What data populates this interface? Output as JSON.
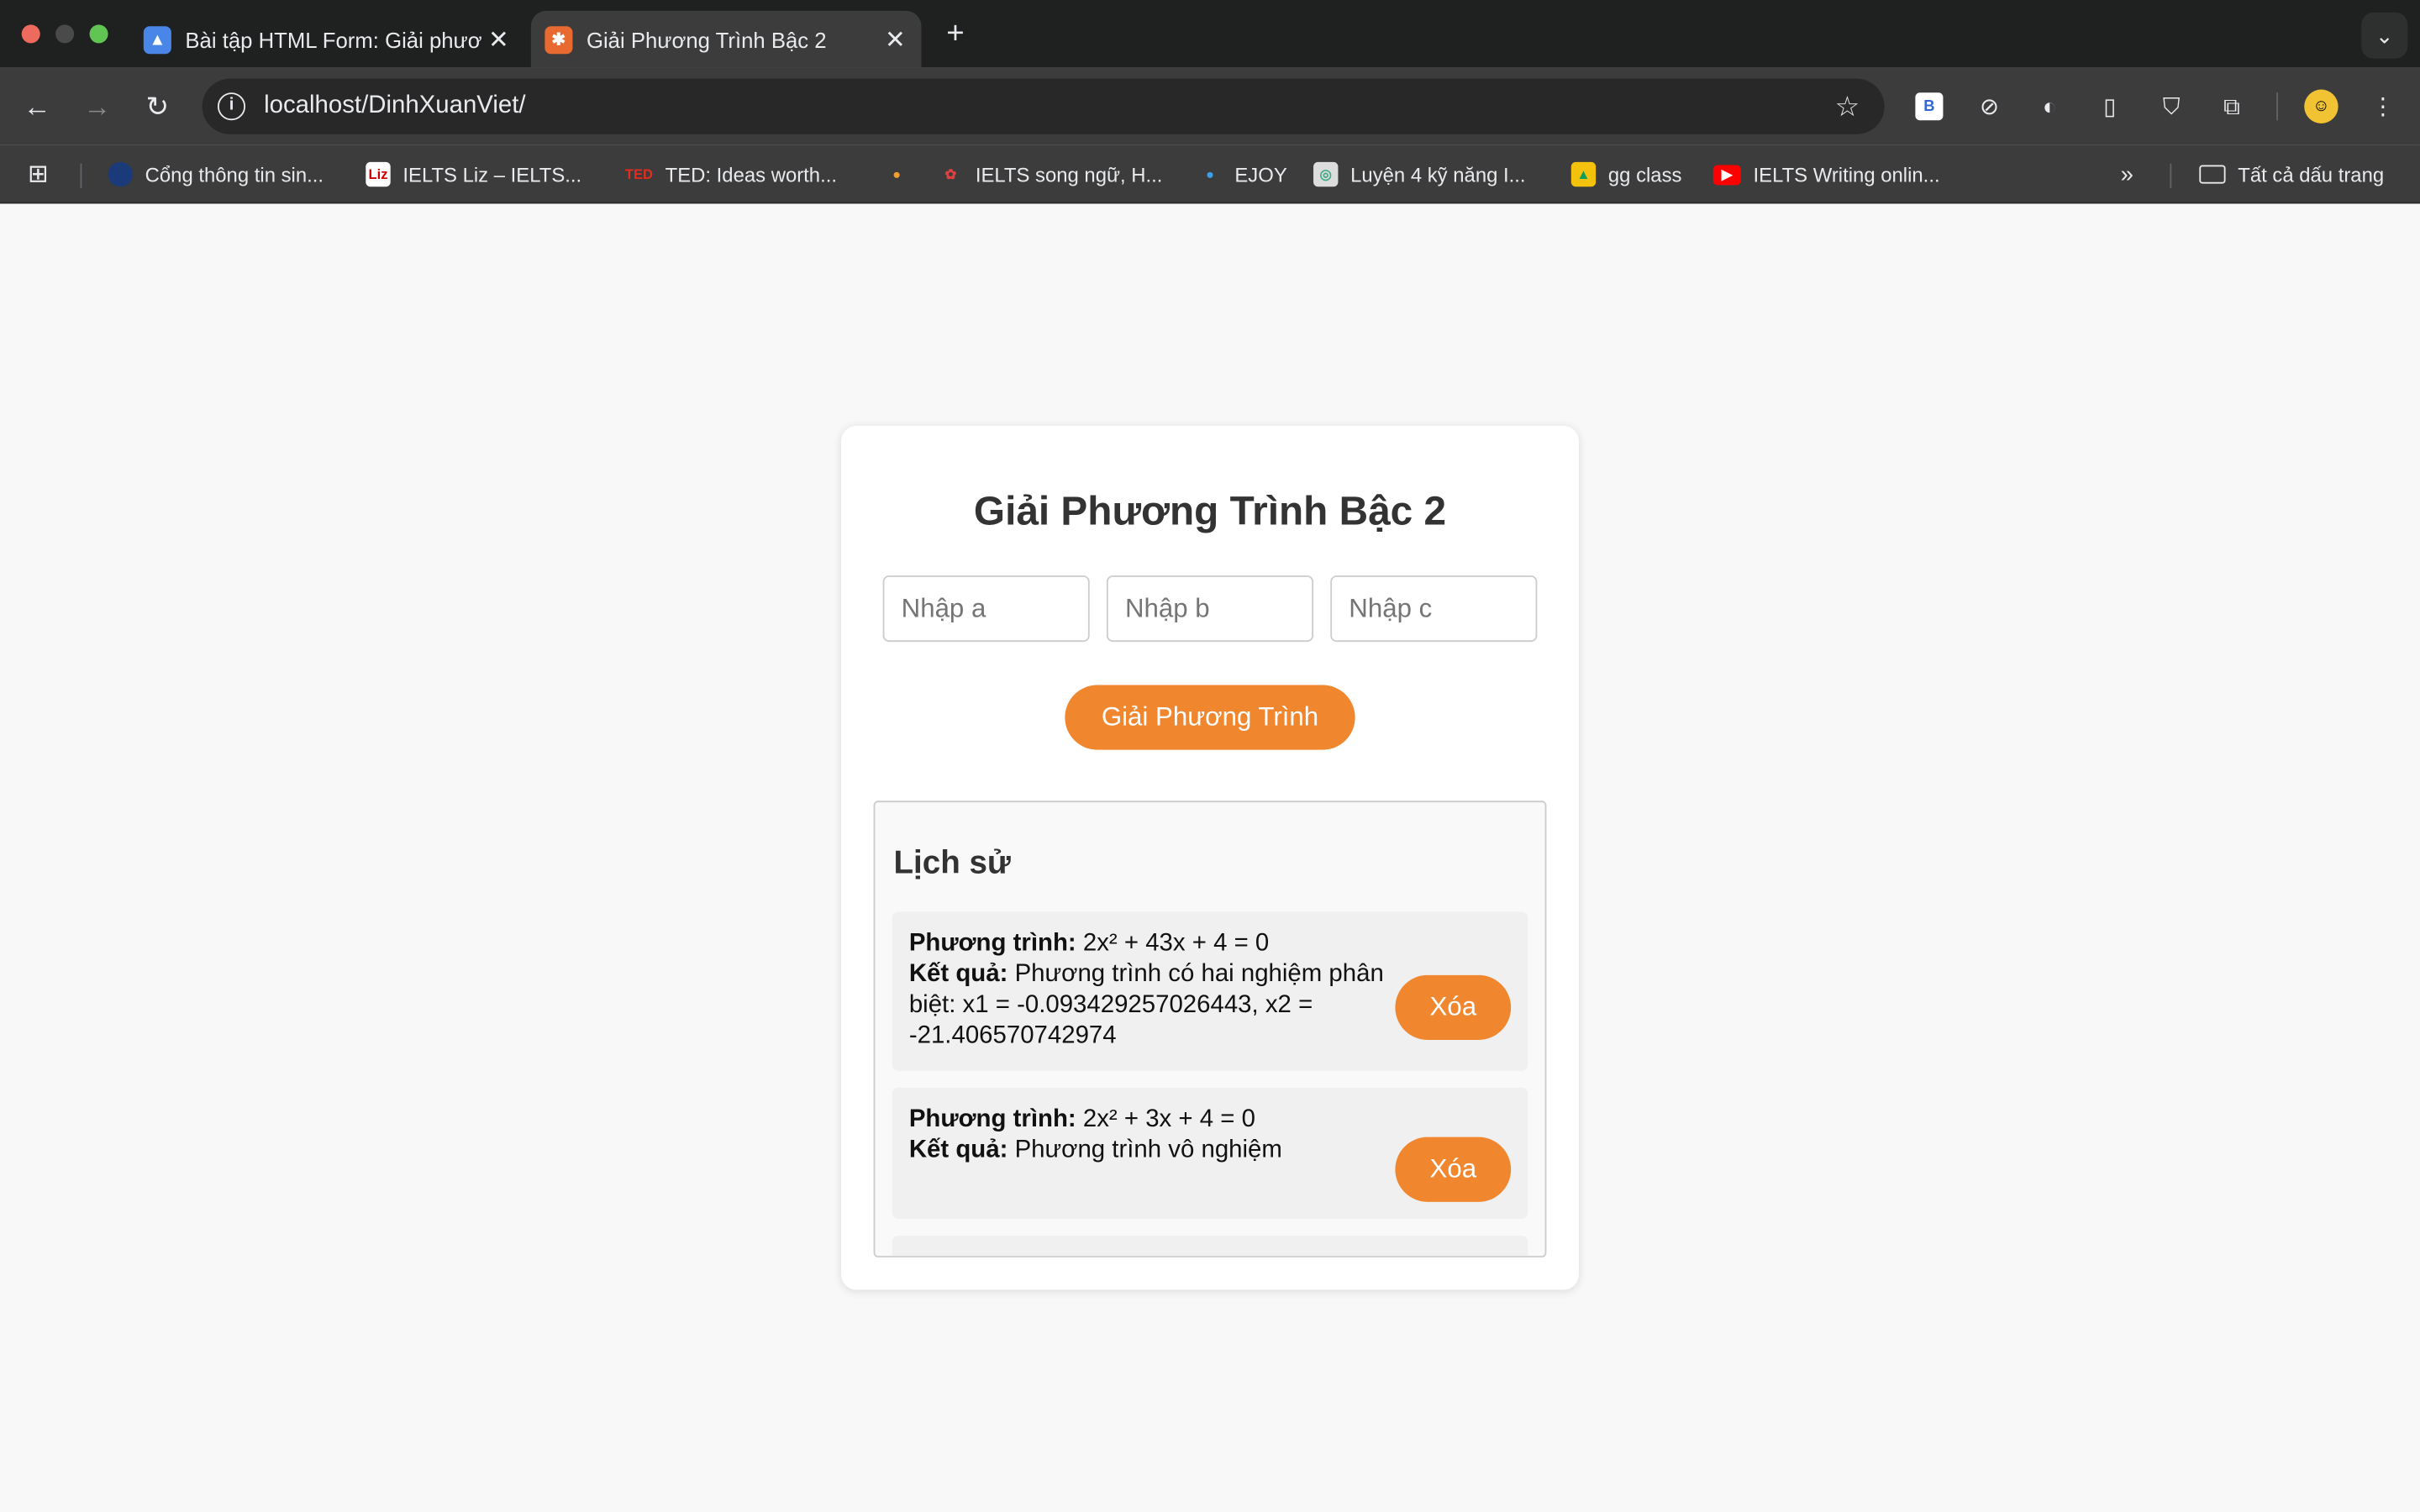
{
  "browser": {
    "tabs": [
      {
        "title": "Bài tập HTML Form: Giải phương",
        "favicon": "classroom-icon"
      },
      {
        "title": "Giải Phương Trình Bậc 2",
        "favicon": "xampp-icon"
      }
    ],
    "url": "localhost/DinhXuanViet/",
    "bookmarks": [
      {
        "label": "Cổng thông tin sin..."
      },
      {
        "label": "IELTS Liz – IELTS..."
      },
      {
        "label": "TED: Ideas worth..."
      },
      {
        "label": ""
      },
      {
        "label": "IELTS song ngữ, H..."
      },
      {
        "label": "EJOY"
      },
      {
        "label": "Luyện 4 kỹ năng I..."
      },
      {
        "label": "gg class"
      },
      {
        "label": "IELTS Writing onlin..."
      }
    ],
    "all_bookmarks_label": "Tất cả dấu trang"
  },
  "page": {
    "title": "Giải Phương Trình Bậc 2",
    "inputs": {
      "a_placeholder": "Nhập a",
      "b_placeholder": "Nhập b",
      "c_placeholder": "Nhập c"
    },
    "solve_label": "Giải Phương Trình",
    "history": {
      "heading": "Lịch sử",
      "equation_label": "Phương trình:",
      "result_label": "Kết quả:",
      "delete_label": "Xóa",
      "items": [
        {
          "equation": "2x² + 43x + 4 = 0",
          "result": "Phương trình có hai nghiệm phân biệt: x1 = -0.093429257026443, x2 = -21.406570742974"
        },
        {
          "equation": "2x² + 3x + 4 = 0",
          "result": "Phương trình vô nghiệm"
        }
      ]
    }
  },
  "colors": {
    "accent": "#f0862e",
    "page_bg": "#f8f8f8",
    "chrome_dark": "#1f2020",
    "chrome_toolbar": "#3c3c3c"
  }
}
